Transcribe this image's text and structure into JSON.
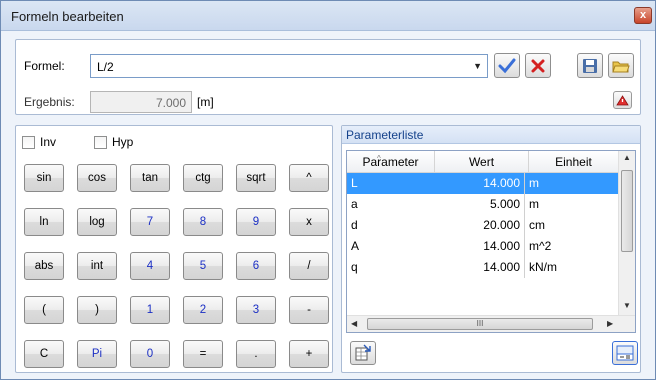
{
  "window": {
    "title": "Formeln bearbeiten",
    "close_glyph": "x"
  },
  "formula": {
    "label": "Formel:",
    "value": "L/2",
    "result_label": "Ergebnis:",
    "result_value": "7.000",
    "result_unit": "[m]"
  },
  "calculator": {
    "inv_label": "Inv",
    "hyp_label": "Hyp",
    "buttons": [
      [
        "sin",
        "cos",
        "tan",
        "ctg",
        "sqrt",
        "^"
      ],
      [
        "ln",
        "log",
        "7",
        "8",
        "9",
        "x"
      ],
      [
        "abs",
        "int",
        "4",
        "5",
        "6",
        "/"
      ],
      [
        "(",
        ")",
        "1",
        "2",
        "3",
        "-"
      ],
      [
        "C",
        "Pi",
        "0",
        "=",
        ".",
        "+"
      ]
    ]
  },
  "params": {
    "title": "Parameterliste",
    "columns": [
      "Parameter",
      "Wert",
      "Einheit"
    ],
    "rows": [
      {
        "name": "L",
        "value": "14.000",
        "unit": "m",
        "selected": true
      },
      {
        "name": "a",
        "value": "5.000",
        "unit": "m",
        "selected": false
      },
      {
        "name": "d",
        "value": "20.000",
        "unit": "cm",
        "selected": false
      },
      {
        "name": "A",
        "value": "14.000",
        "unit": "m^2",
        "selected": false
      },
      {
        "name": "q",
        "value": "14.000",
        "unit": "kN/m",
        "selected": false
      }
    ],
    "scroll_grip": "III"
  },
  "colors": {
    "selection": "#3399ff",
    "number_key": "#1b2fc4",
    "accept_check": "#3a6fd8",
    "reject_x": "#d42020"
  }
}
